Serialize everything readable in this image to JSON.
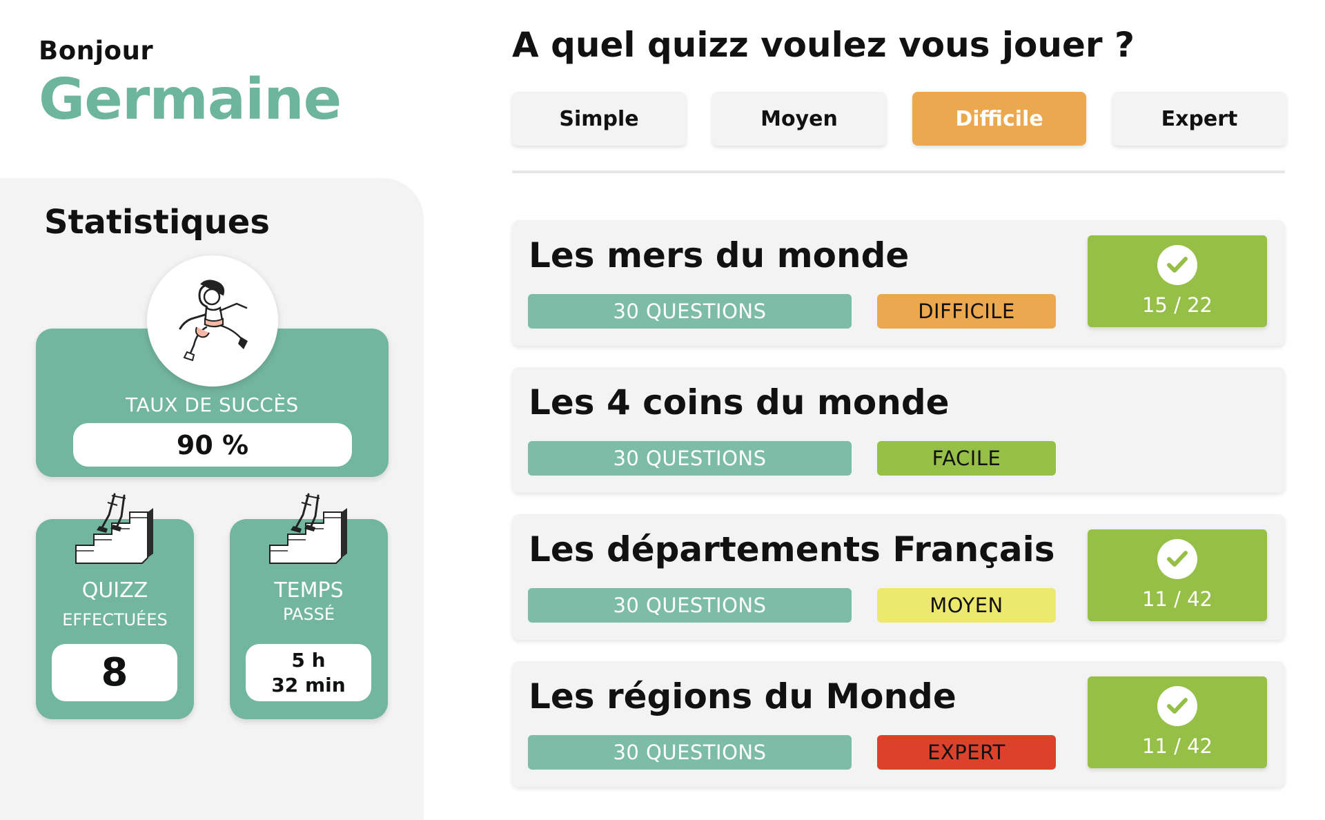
{
  "greeting": {
    "hello": "Bonjour",
    "name": "Germaine"
  },
  "stats": {
    "title": "Statistiques",
    "success": {
      "label": "TAUX DE SUCCÈS",
      "value": "90 %"
    },
    "quizz_done": {
      "label_line1": "QUIZZ",
      "label_line2": "EFFECTUÉES",
      "value": "8"
    },
    "time_spent": {
      "label_line1": "TEMPS",
      "label_line2": "PASSÉ",
      "value_line1": "5 h",
      "value_line2": "32 min"
    }
  },
  "question": "A quel quizz voulez vous jouer ?",
  "levels": [
    {
      "label": "Simple",
      "active": false
    },
    {
      "label": "Moyen",
      "active": false
    },
    {
      "label": "Difficile",
      "active": true
    },
    {
      "label": "Expert",
      "active": false
    }
  ],
  "quizzes": [
    {
      "title": "Les mers du monde",
      "questions": "30 QUESTIONS",
      "difficulty": "DIFFICILE",
      "difficulty_color": "#eca84e",
      "done": true,
      "score": "15 / 22"
    },
    {
      "title": "Les 4 coins du monde",
      "questions": "30 QUESTIONS",
      "difficulty": "FACILE",
      "difficulty_color": "#95bf46",
      "done": false,
      "score": ""
    },
    {
      "title": "Les départements Français",
      "questions": "30 QUESTIONS",
      "difficulty": "MOYEN",
      "difficulty_color": "#ede86f",
      "done": true,
      "score": "11 / 42"
    },
    {
      "title": "Les régions du Monde",
      "questions": "30 QUESTIONS",
      "difficulty": "EXPERT",
      "difficulty_color": "#db412b",
      "done": true,
      "score": "11 / 42"
    }
  ],
  "colors": {
    "accent_green": "#73b6a0",
    "active_level": "#eca84e",
    "score_green": "#95bf46"
  }
}
